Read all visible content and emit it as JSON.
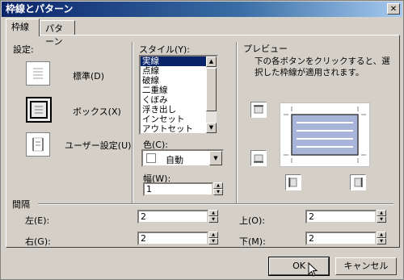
{
  "window": {
    "title": "枠線とパターン",
    "close_label": "✕"
  },
  "tabs": [
    {
      "label": "枠線"
    },
    {
      "label": "パターン"
    }
  ],
  "settings": {
    "label": "設定:",
    "presets": [
      {
        "label": "標準(D)"
      },
      {
        "label": "ボックス(X)"
      },
      {
        "label": "ユーザー設定(U)"
      }
    ]
  },
  "style": {
    "label": "スタイル(Y):",
    "items": [
      "実線",
      "点線",
      "破線",
      "二重線",
      "くぼみ",
      "浮き出し",
      "インセット",
      "アウトセット"
    ],
    "selected": "実線",
    "color_label": "色(C):",
    "color_value": "自動",
    "width_label": "幅(W):",
    "width_value": "1"
  },
  "preview": {
    "label": "プレビュー",
    "instructions": "下の各ボタンをクリックすると、選択した枠線が適用されます。"
  },
  "spacing": {
    "label": "間隔",
    "left_label": "左(E):",
    "left_value": "2",
    "top_label": "上(O):",
    "top_value": "2",
    "right_label": "右(G):",
    "right_value": "2",
    "bottom_label": "下(M):",
    "bottom_value": "2"
  },
  "buttons": {
    "ok": "OK",
    "cancel": "キャンセル"
  },
  "colors": {
    "titlebar": "#0a246a",
    "selection": "#0a246a",
    "preview_fill": "#a8b4d8"
  }
}
